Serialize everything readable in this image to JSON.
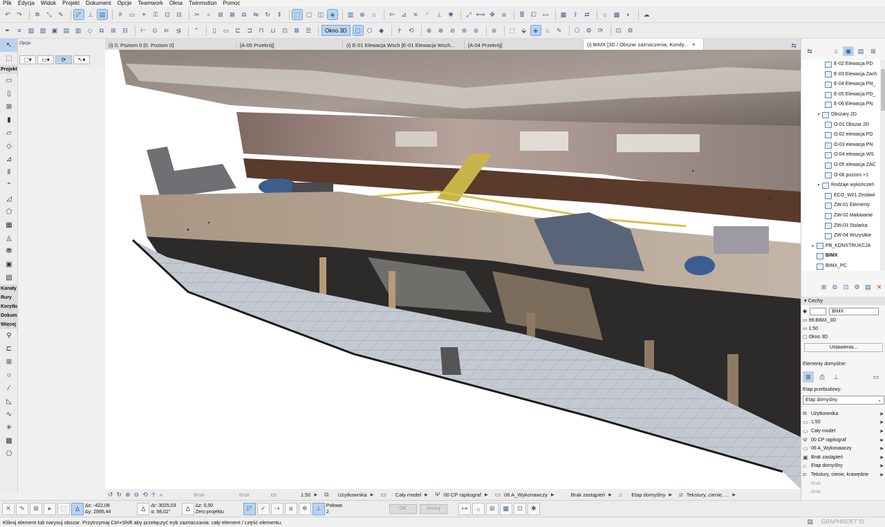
{
  "menu": [
    "Plik",
    "Edycja",
    "Widok",
    "Projekt",
    "Dokument",
    "Opcje",
    "Teamwork",
    "Okna",
    "Twinmotion",
    "Pomoc"
  ],
  "toolbar": {
    "okno3d_label": "Okno 3D"
  },
  "infobox": {
    "opcje_label": "Opcje:"
  },
  "toolbox": {
    "projekt": "Projekt",
    "kanaly": "Kanały",
    "rury": "Rury",
    "korytk": "Korytka",
    "dokum": "Dokumentacja",
    "wiecej": "Więcej"
  },
  "tabs": [
    {
      "label": "(i) 0. Poziom 0 [0. Poziom 0]"
    },
    {
      "label": "[A-05 Przekrój]"
    },
    {
      "label": "(i) E-01 Elewacja Wsch [E-01 Elewacja Wsch..."
    },
    {
      "label": "[A-04 Przekrój]"
    },
    {
      "label": "(i) BIMX [3D / Obszar zaznaczenia, Kondy..."
    }
  ],
  "viewport_bar": {
    "brak1": "Brak",
    "brak2": "Brak",
    "scale": "1:50",
    "layer": "Użytkownika",
    "model": "Cały model",
    "pen": "00 CP rapitograf",
    "mvo": "06 A_Wykonawczy",
    "override": "Brak zastąpień",
    "phase": "Etap domyślny",
    "textures": "Tekstury, cienie, ..."
  },
  "coords": {
    "dx": "Δx: -422,08",
    "dy": "Δy: 2995,44",
    "dr": "Δr: 3025,03",
    "angle": "α: 98,02°",
    "dz": "Δz: 0,00",
    "zero": "Zero projektu",
    "polowa": "Połowa",
    "polowa_n": "2",
    "ok": "OK",
    "anuluj": "Anuluj"
  },
  "status": {
    "message": "Kliknij element lub narysuj obszar. Przytrzymaj Ctrl+Shift aby przełączyć tryb zaznaczania: cały element / część elementu.",
    "brand": "GRAPHISOFT ID"
  },
  "navigator": {
    "items": [
      {
        "label": "E-02 Elewacja PD",
        "level": 2,
        "tw": ""
      },
      {
        "label": "E-03 Elewacja Zach",
        "level": 2,
        "tw": ""
      },
      {
        "label": "E-04 Elewacja PN_",
        "level": 2,
        "tw": ""
      },
      {
        "label": "E-05 Elewacja PD_",
        "level": 2,
        "tw": ""
      },
      {
        "label": "E-06 Elewacja PN",
        "level": 2,
        "tw": ""
      },
      {
        "label": "Obszary 2D",
        "level": 1,
        "tw": "v"
      },
      {
        "label": "O-01 Obszar 2D",
        "level": 2,
        "tw": ""
      },
      {
        "label": "O-02 elewacja PD",
        "level": 2,
        "tw": ""
      },
      {
        "label": "O-03 elewacja PN",
        "level": 2,
        "tw": ""
      },
      {
        "label": "O-04 elewacja WS",
        "level": 2,
        "tw": ""
      },
      {
        "label": "O-05 elewacja ZAC",
        "level": 2,
        "tw": ""
      },
      {
        "label": "O-06 poziom +1",
        "level": 2,
        "tw": ""
      },
      {
        "label": "Rodzaje wykończeń",
        "level": 1,
        "tw": "v"
      },
      {
        "label": "ECO_W01 Zestawi",
        "level": 2,
        "tw": ""
      },
      {
        "label": "ZW-01 Elementy",
        "level": 2,
        "tw": ""
      },
      {
        "label": "ZW-02 Malowanie",
        "level": 2,
        "tw": ""
      },
      {
        "label": "ZW-03 Stolarka",
        "level": 2,
        "tw": ""
      },
      {
        "label": "ZW-04 Wszystkie",
        "level": 2,
        "tw": ""
      },
      {
        "label": "PB_KONSTRUKCJA",
        "level": 0,
        "tw": ">"
      },
      {
        "label": "BIMX",
        "level": 0,
        "tw": "",
        "bold": true
      },
      {
        "label": "BIMX_PC",
        "level": 0,
        "tw": ""
      }
    ]
  },
  "properties": {
    "header": "Cechy",
    "id": "BIMX",
    "name": "99.BIMX_3D",
    "scale": "1:50",
    "type": "Okno 3D",
    "settings_button": "Ustawienia...",
    "defaults_label": "Elementy domyślne:",
    "phase_label": "Etap przebudowy:",
    "phase_value": "Etap domyślny",
    "list": [
      {
        "icon": "layers-icon",
        "label": "Użytkownika",
        "grey": false
      },
      {
        "icon": "scale-icon",
        "label": "1:50",
        "grey": false
      },
      {
        "icon": "model-icon",
        "label": "Cały model",
        "grey": false
      },
      {
        "icon": "pen-icon",
        "label": "00 CP rapitograf",
        "grey": false
      },
      {
        "icon": "mvo-icon",
        "label": "06 A_Wykonawczy",
        "grey": false
      },
      {
        "icon": "override-icon",
        "label": "Brak zastąpień",
        "grey": false
      },
      {
        "icon": "phase-icon",
        "label": "Etap domyślny",
        "grey": false
      },
      {
        "icon": "texture-icon",
        "label": "Tekstury, cienie, krawędzie",
        "grey": false
      },
      {
        "icon": "empty-icon",
        "label": "Brak",
        "grey": true
      },
      {
        "icon": "empty-icon",
        "label": "Brak",
        "grey": true
      }
    ]
  }
}
